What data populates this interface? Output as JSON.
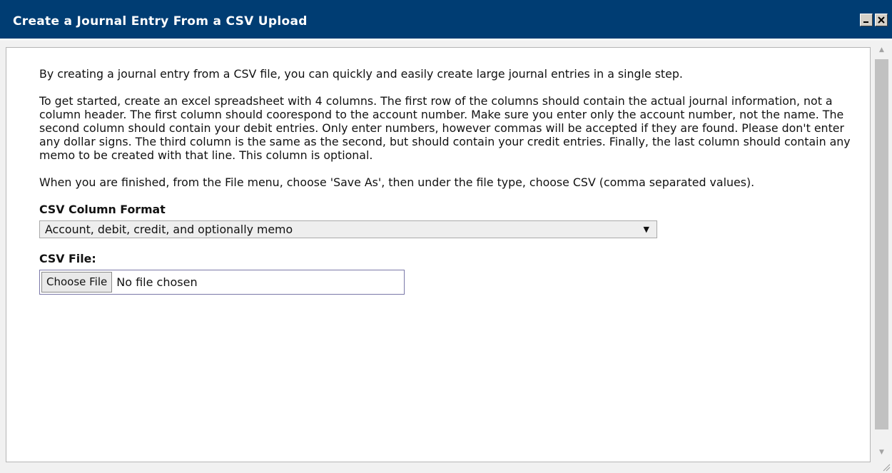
{
  "window": {
    "title": "Create a Journal Entry From a CSV Upload"
  },
  "content": {
    "paragraphs": [
      "By creating a journal entry from a CSV file, you can quickly and easily create large journal entries in a single step.",
      "To get started, create an excel spreadsheet with 4 columns. The first row of the columns should contain the actual journal information, not a column header. The first column should coorespond to the account number. Make sure you enter only the account number, not the name. The second column should contain your debit entries. Only enter numbers, however commas will be accepted if they are found. Please don't enter any dollar signs. The third column is the same as the second, but should contain your credit entries. Finally, the last column should contain any memo to be created with that line. This column is optional.",
      "When you are finished, from the File menu, choose 'Save As', then under the file type, choose CSV (comma separated values)."
    ],
    "format_label": "CSV Column Format",
    "format_selected": "Account, debit, credit, and optionally memo",
    "file_label": "CSV File:",
    "choose_button": "Choose File",
    "file_status": "No file chosen"
  },
  "icons": {
    "minimize": "minimize-icon",
    "close": "close-icon",
    "dropdown": "dropdown-arrow-icon",
    "scroll_up": "scroll-up-arrow-icon",
    "scroll_down": "scroll-down-arrow-icon",
    "resize": "resize-grip-icon"
  },
  "colors": {
    "titlebar": "#003d73",
    "title_text": "#ffffff"
  }
}
